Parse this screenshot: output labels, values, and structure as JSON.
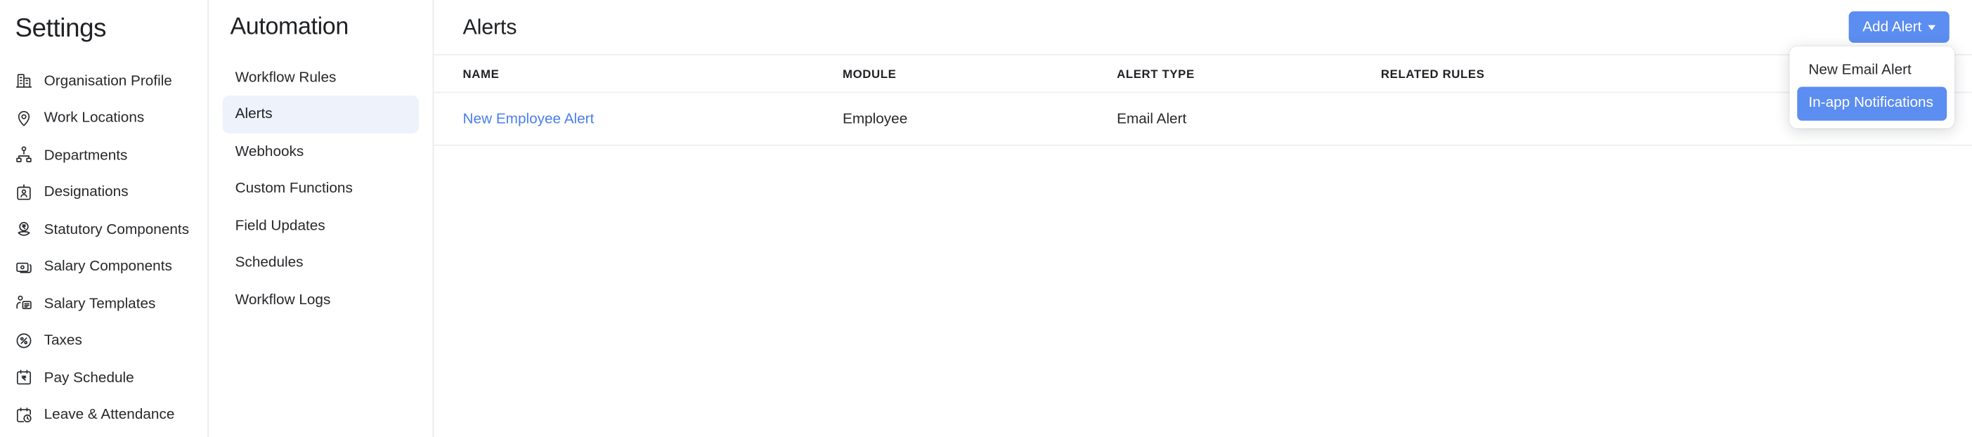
{
  "settings": {
    "title": "Settings",
    "items": [
      {
        "label": "Organisation Profile",
        "icon": "building-icon"
      },
      {
        "label": "Work Locations",
        "icon": "map-pin-icon"
      },
      {
        "label": "Departments",
        "icon": "org-chart-icon"
      },
      {
        "label": "Designations",
        "icon": "id-badge-icon"
      },
      {
        "label": "Statutory Components",
        "icon": "rupee-hand-icon"
      },
      {
        "label": "Salary Components",
        "icon": "cards-icon"
      },
      {
        "label": "Salary Templates",
        "icon": "person-document-icon"
      },
      {
        "label": "Taxes",
        "icon": "percent-circle-icon"
      },
      {
        "label": "Pay Schedule",
        "icon": "calendar-rupee-icon"
      },
      {
        "label": "Leave & Attendance",
        "icon": "calendar-clock-icon"
      }
    ]
  },
  "automation": {
    "title": "Automation",
    "active": "Alerts",
    "items": [
      {
        "label": "Workflow Rules"
      },
      {
        "label": "Alerts"
      },
      {
        "label": "Webhooks"
      },
      {
        "label": "Custom Functions"
      },
      {
        "label": "Field Updates"
      },
      {
        "label": "Schedules"
      },
      {
        "label": "Workflow Logs"
      }
    ]
  },
  "main": {
    "page_title": "Alerts",
    "add_alert_button": "Add Alert",
    "dropdown": {
      "open": true,
      "items": [
        {
          "label": "New Email Alert",
          "highlighted": false
        },
        {
          "label": "In-app Notifications",
          "highlighted": true
        }
      ]
    },
    "table": {
      "columns": [
        "NAME",
        "MODULE",
        "ALERT TYPE",
        "RELATED RULES"
      ],
      "rows": [
        {
          "name": "New Employee Alert",
          "module": "Employee",
          "alert_type": "Email Alert",
          "related_rules": ""
        }
      ]
    }
  },
  "colors": {
    "accent_blue": "#5c8df0",
    "link_blue": "#4a7ef0",
    "active_nav_bg": "#edf2fb",
    "border": "#eceef0",
    "text_primary": "#26282b"
  }
}
